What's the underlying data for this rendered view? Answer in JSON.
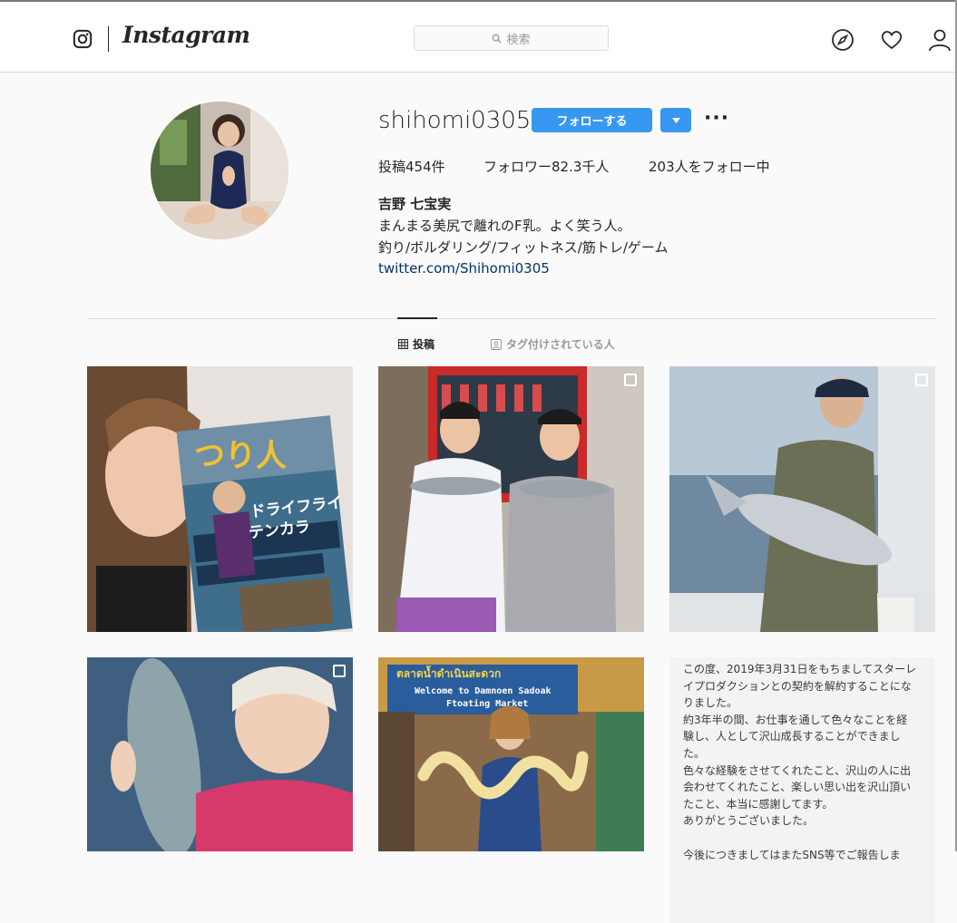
{
  "header": {
    "brand": "Instagram",
    "search_placeholder": "検索"
  },
  "profile": {
    "username": "shihomi0305",
    "follow_label": "フォローする",
    "posts": "投稿454件",
    "followers": "フォロワー82.3千人",
    "following": "203人をフォロー中",
    "full_name": "吉野 七宝実",
    "bio_line1": "まんまる美尻で離れのF乳。よく笑う人。",
    "bio_line2": "釣り/ボルダリング/フィットネス/筋トレ/ゲーム",
    "link": "twitter.com/Shihomi0305"
  },
  "tabs": {
    "posts_label": "投稿",
    "tagged_label": "タグ付けされている人"
  },
  "posts": {
    "magazine_title": "つり人",
    "magazine_headline1": "ドライフライ",
    "magazine_headline2": "テンカラ",
    "market_sign_line1": "Welcome to Damnoen Sadoak",
    "market_sign_line2": "Ftoating Market",
    "notice_lines": [
      "この度、2019年3月31日をもちましてスターレ",
      "イプロダクションとの契約を解約することにな",
      "りました。",
      "約3年半の間、お仕事を通して色々なことを経",
      "験し、人として沢山成長することができまし",
      "た。",
      "色々な経験をさせてくれたこと、沢山の人に出",
      "会わせてくれたこと、楽しい思い出を沢山頂い",
      "たこと、本当に感謝してます。",
      "ありがとうございました。",
      "",
      "今後につきましてはまたSNS等でご報告しま"
    ]
  },
  "colors": {
    "accent": "#3897f0",
    "link": "#003569",
    "border": "#dbdbdb"
  }
}
